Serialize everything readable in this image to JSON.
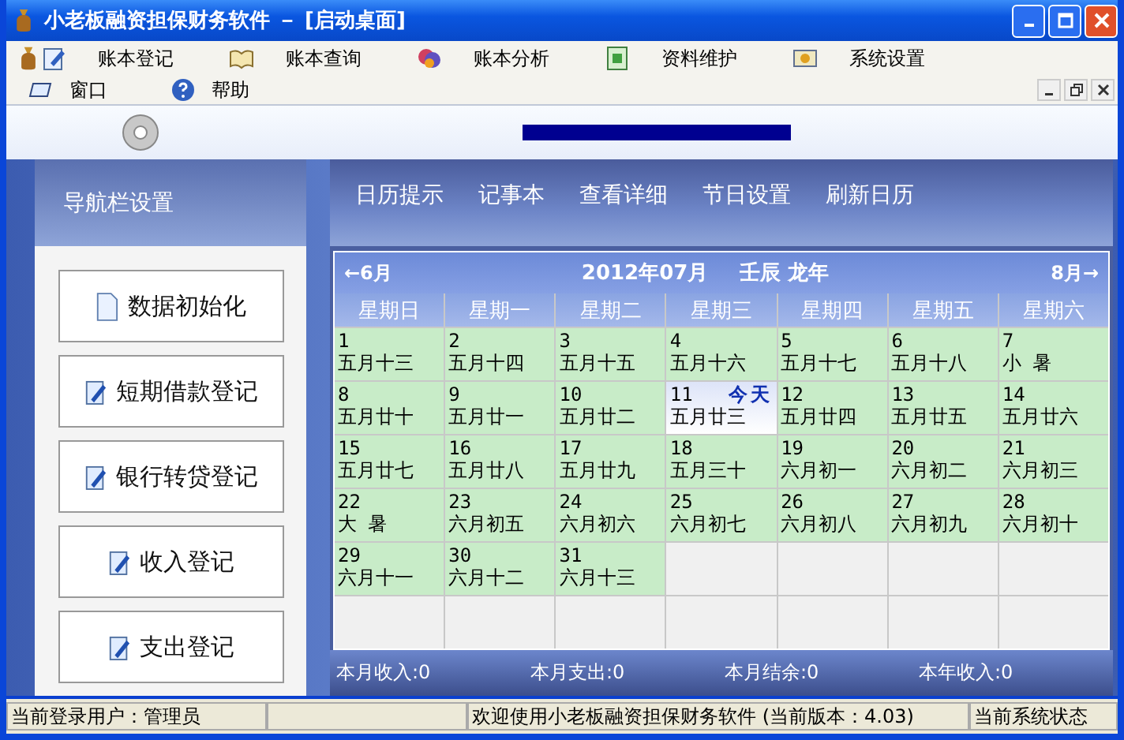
{
  "window": {
    "title": "小老板融资担保财务软件 － [启动桌面]"
  },
  "menu_bar": [
    {
      "label": "账本登记",
      "kind": "edit"
    },
    {
      "label": "账本查询",
      "kind": "book"
    },
    {
      "label": "账本分析",
      "kind": "chart"
    },
    {
      "label": "资料维护",
      "kind": "folder"
    },
    {
      "label": "系统设置",
      "kind": "screen"
    }
  ],
  "menu_bar_2": [
    {
      "label": "窗口",
      "kind": "window"
    },
    {
      "label": "帮助",
      "kind": "help"
    }
  ],
  "navigation": {
    "title": "导航栏设置",
    "items": [
      {
        "label": "数据初始化",
        "kind": "doc"
      },
      {
        "label": "短期借款登记",
        "kind": "edit"
      },
      {
        "label": "银行转贷登记",
        "kind": "edit"
      },
      {
        "label": "收入登记",
        "kind": "edit"
      },
      {
        "label": "支出登记",
        "kind": "edit"
      }
    ]
  },
  "toolbar": [
    "日历提示",
    "记事本",
    "查看详细",
    "节日设置",
    "刷新日历"
  ],
  "calendar": {
    "prev": "←6月",
    "title": "2012年07月",
    "lunar_year": "壬辰 龙年",
    "next": "8月→",
    "weekdays": [
      "星期日",
      "星期一",
      "星期二",
      "星期三",
      "星期四",
      "星期五",
      "星期六"
    ],
    "weeks": [
      [
        {
          "kind": "day",
          "day": "1",
          "lunar": "五月十三",
          "today": false
        },
        {
          "kind": "day",
          "day": "2",
          "lunar": "五月十四",
          "today": false
        },
        {
          "kind": "day",
          "day": "3",
          "lunar": "五月十五",
          "today": false
        },
        {
          "kind": "day",
          "day": "4",
          "lunar": "五月十六",
          "today": false
        },
        {
          "kind": "day",
          "day": "5",
          "lunar": "五月十七",
          "today": false
        },
        {
          "kind": "day",
          "day": "6",
          "lunar": "五月十八",
          "today": false
        },
        {
          "kind": "day",
          "day": "7",
          "lunar": "小 暑",
          "today": false
        }
      ],
      [
        {
          "kind": "day",
          "day": "8",
          "lunar": "五月廿十",
          "today": false
        },
        {
          "kind": "day",
          "day": "9",
          "lunar": "五月廿一",
          "today": false
        },
        {
          "kind": "day",
          "day": "10",
          "lunar": "五月廿二",
          "today": false
        },
        {
          "kind": "day",
          "day": "11",
          "lunar": "五月廿三",
          "today": true,
          "badge": "今天"
        },
        {
          "kind": "day",
          "day": "12",
          "lunar": "五月廿四",
          "today": false
        },
        {
          "kind": "day",
          "day": "13",
          "lunar": "五月廿五",
          "today": false
        },
        {
          "kind": "day",
          "day": "14",
          "lunar": "五月廿六",
          "today": false
        }
      ],
      [
        {
          "kind": "day",
          "day": "15",
          "lunar": "五月廿七",
          "today": false
        },
        {
          "kind": "day",
          "day": "16",
          "lunar": "五月廿八",
          "today": false
        },
        {
          "kind": "day",
          "day": "17",
          "lunar": "五月廿九",
          "today": false
        },
        {
          "kind": "day",
          "day": "18",
          "lunar": "五月三十",
          "today": false
        },
        {
          "kind": "day",
          "day": "19",
          "lunar": "六月初一",
          "today": false
        },
        {
          "kind": "day",
          "day": "20",
          "lunar": "六月初二",
          "today": false
        },
        {
          "kind": "day",
          "day": "21",
          "lunar": "六月初三",
          "today": false
        }
      ],
      [
        {
          "kind": "day",
          "day": "22",
          "lunar": "大 暑",
          "today": false
        },
        {
          "kind": "day",
          "day": "23",
          "lunar": "六月初五",
          "today": false
        },
        {
          "kind": "day",
          "day": "24",
          "lunar": "六月初六",
          "today": false
        },
        {
          "kind": "day",
          "day": "25",
          "lunar": "六月初七",
          "today": false
        },
        {
          "kind": "day",
          "day": "26",
          "lunar": "六月初八",
          "today": false
        },
        {
          "kind": "day",
          "day": "27",
          "lunar": "六月初九",
          "today": false
        },
        {
          "kind": "day",
          "day": "28",
          "lunar": "六月初十",
          "today": false
        }
      ],
      [
        {
          "kind": "day",
          "day": "29",
          "lunar": "六月十一",
          "today": false
        },
        {
          "kind": "day",
          "day": "30",
          "lunar": "六月十二",
          "today": false
        },
        {
          "kind": "day",
          "day": "31",
          "lunar": "六月十三",
          "today": false
        },
        {
          "kind": "blank"
        },
        {
          "kind": "blank"
        },
        {
          "kind": "blank"
        },
        {
          "kind": "blank"
        }
      ],
      [
        {
          "kind": "blank"
        },
        {
          "kind": "blank"
        },
        {
          "kind": "blank"
        },
        {
          "kind": "blank"
        },
        {
          "kind": "blank"
        },
        {
          "kind": "blank"
        },
        {
          "kind": "blank"
        }
      ]
    ],
    "summary": [
      "本月收入:0",
      "本月支出:0",
      "本月结余:0",
      "本年收入:0"
    ]
  },
  "status_bar": [
    "当前登录用户：管理员",
    "欢迎使用小老板融资担保财务软件  (当前版本：4.03)",
    "当前系统状态"
  ]
}
